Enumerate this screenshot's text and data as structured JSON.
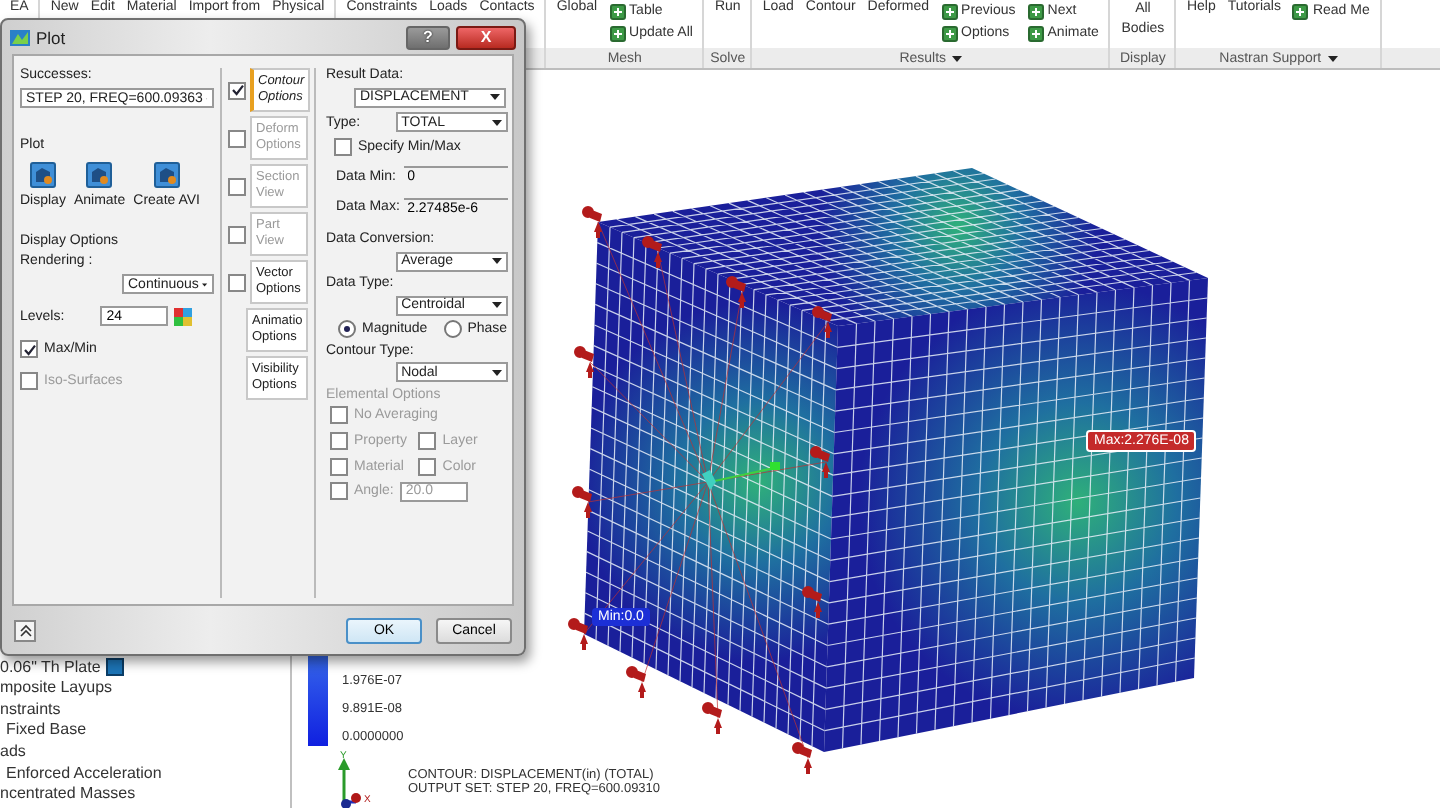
{
  "ribbon": {
    "groups": [
      {
        "items": [
          {
            "label": "EA",
            "kind": "large"
          }
        ]
      },
      {
        "items": [
          {
            "label": "New",
            "kind": "large"
          },
          {
            "label": "Edit",
            "kind": "large"
          },
          {
            "label": "Material",
            "kind": "large"
          },
          {
            "label": "Import from",
            "kind": "large"
          },
          {
            "label": "Physical",
            "kind": "large"
          }
        ]
      },
      {
        "items": [
          {
            "label": "Constraints",
            "kind": "large"
          },
          {
            "label": "Loads",
            "kind": "large"
          },
          {
            "label": "Contacts",
            "kind": "large"
          }
        ]
      },
      {
        "label": "Mesh",
        "items": [
          {
            "label": "Global",
            "kind": "large"
          },
          {
            "label": "Table",
            "kind": "small"
          },
          {
            "label": "Update All",
            "kind": "small"
          }
        ]
      },
      {
        "label": "Solve",
        "items": [
          {
            "label": "Run",
            "kind": "large"
          }
        ]
      },
      {
        "label": "Results",
        "dropdown": true,
        "items": [
          {
            "label": "Load",
            "kind": "large"
          },
          {
            "label": "Contour",
            "kind": "large"
          },
          {
            "label": "Deformed",
            "kind": "large"
          },
          {
            "label": "Previous",
            "kind": "small"
          },
          {
            "label": "Options",
            "kind": "small"
          },
          {
            "label": "Next",
            "kind": "small"
          },
          {
            "label": "Animate",
            "kind": "small"
          }
        ]
      },
      {
        "label": "Display",
        "items": [
          {
            "label": "All Bodies",
            "kind": "large"
          }
        ]
      },
      {
        "label": "Nastran Support",
        "dropdown": true,
        "items": [
          {
            "label": "Help",
            "kind": "large"
          },
          {
            "label": "Tutorials",
            "kind": "large"
          },
          {
            "label": "Read Me",
            "kind": "small"
          }
        ]
      }
    ]
  },
  "tree": {
    "items": [
      {
        "label": "0.06\" Th Plate"
      },
      {
        "label": "mposite Layups"
      },
      {
        "label": "nstraints",
        "children": [
          {
            "label": "Fixed Base"
          }
        ]
      },
      {
        "label": "ads",
        "children": [
          {
            "label": "Enforced Acceleration"
          }
        ]
      },
      {
        "label": "ncentrated Masses"
      }
    ]
  },
  "canvas": {
    "max_label": "Max:2.276E-08",
    "min_label": "Min:0.0",
    "legend": [
      "1.976E-07",
      "9.891E-08",
      "0.0000000"
    ],
    "triad": {
      "y": "Y",
      "x": "X"
    },
    "caption": [
      "CONTOUR: DISPLACEMENT(in) (TOTAL)",
      "OUTPUT SET: STEP 20, FREQ=600.09310"
    ]
  },
  "dialog": {
    "title": "Plot",
    "help_button": "?",
    "close_button": "X",
    "left": {
      "successes_label": "Successes:",
      "successes_value": "STEP 20, FREQ=600.09363",
      "plot_label": "Plot",
      "plot_buttons": [
        "Display",
        "Animate",
        "Create AVI"
      ],
      "display_options_label": "Display Options",
      "rendering_label": "Rendering :",
      "rendering_value": "Continuous",
      "levels_label": "Levels:",
      "levels_value": "24",
      "checks": [
        {
          "label": "Max/Min",
          "checked": true,
          "disabled": false
        },
        {
          "label": "Iso-Surfaces",
          "checked": false,
          "disabled": true
        }
      ]
    },
    "tabs": [
      {
        "label": "Contour Options",
        "kind": "check",
        "checked": true,
        "selected": true,
        "disabled": false
      },
      {
        "label": "Deform Options",
        "kind": "check",
        "checked": false,
        "selected": false,
        "disabled": true
      },
      {
        "label": "Section View",
        "kind": "check",
        "checked": false,
        "selected": false,
        "disabled": true
      },
      {
        "label": "Part View",
        "kind": "check",
        "checked": false,
        "selected": false,
        "disabled": true
      },
      {
        "label": "Vector Options",
        "kind": "check",
        "checked": false,
        "selected": false,
        "disabled": false
      },
      {
        "label": "Animatio Options",
        "kind": "plain",
        "selected": false,
        "disabled": false
      },
      {
        "label": "Visibility Options",
        "kind": "plain",
        "selected": false,
        "disabled": false
      }
    ],
    "panel": {
      "result_data_label": "Result Data:",
      "result_data_value": "DISPLACEMENT",
      "type_label": "Type:",
      "type_value": "TOTAL",
      "specify": {
        "label": "Specify Min/Max",
        "checked": false
      },
      "data_min_label": "Data Min:",
      "data_min_value": "0",
      "data_max_label": "Data Max:",
      "data_max_value": "2.27485e-6",
      "conversion_label": "Data Conversion:",
      "conversion_value": "Average",
      "data_type_label": "Data Type:",
      "data_type_value": "Centroidal",
      "radios": [
        {
          "label": "Magnitude",
          "selected": true
        },
        {
          "label": "Phase",
          "selected": false
        }
      ],
      "contour_type_label": "Contour Type:",
      "contour_type_value": "Nodal",
      "elemental_label": "Elemental Options",
      "elemental_disabled": true,
      "elemental_checks": [
        {
          "label": "No Averaging",
          "checked": false
        },
        {
          "label": "Property",
          "checked": false
        },
        {
          "label": "Layer",
          "checked": false
        },
        {
          "label": "Material",
          "checked": false
        },
        {
          "label": "Color",
          "checked": false
        }
      ],
      "angle": {
        "label": "Angle:",
        "checked": false,
        "value": "20.0"
      }
    },
    "ok_button": "OK",
    "cancel_button": "Cancel"
  }
}
